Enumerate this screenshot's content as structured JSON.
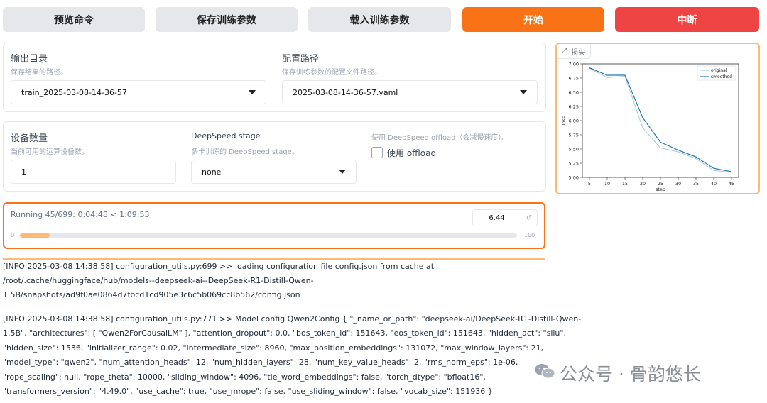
{
  "buttons": {
    "preview": "预览命令",
    "save": "保存训练参数",
    "load": "载入训练参数",
    "start": "开始",
    "stop": "中断"
  },
  "output_dir": {
    "label": "输出目录",
    "info": "保存结果的路径。",
    "value": "train_2025-03-08-14-36-57"
  },
  "config_path": {
    "label": "配置路径",
    "info": "保存训练参数的配置文件路径。",
    "value": "2025-03-08-14-36-57.yaml"
  },
  "device_count": {
    "label": "设备数量",
    "info": "当前可用的运算设备数。",
    "value": "1"
  },
  "deepspeed": {
    "label": "DeepSpeed stage",
    "info": "多卡训练的 DeepSpeed stage。",
    "value": "none"
  },
  "offload": {
    "info": "使用 DeepSpeed offload（会减慢速度）。",
    "label": "使用 offload",
    "checked": false
  },
  "progress": {
    "status": "Running 45/699: 0:04:48 < 1:09:53",
    "value": "6.44",
    "min": "0",
    "max": "100",
    "fraction": 0.06
  },
  "loss_chart": {
    "tab_label": "损失"
  },
  "chart_data": {
    "type": "line",
    "x": [
      5,
      10,
      15,
      20,
      25,
      30,
      35,
      40,
      45
    ],
    "series": [
      {
        "name": "original",
        "values": [
          6.92,
          6.76,
          6.78,
          5.87,
          5.52,
          5.45,
          5.33,
          5.12,
          5.09
        ]
      },
      {
        "name": "smoothed",
        "values": [
          6.93,
          6.8,
          6.8,
          6.05,
          5.62,
          5.48,
          5.36,
          5.16,
          5.1
        ]
      }
    ],
    "xlabel": "step",
    "ylabel": "loss",
    "ylim": [
      5.0,
      7.0
    ],
    "yticks": [
      "7.00",
      "6.75",
      "6.50",
      "6.25",
      "6.00",
      "5.75",
      "5.50",
      "5.25",
      "5.00"
    ],
    "xticks": [
      "5",
      "10",
      "15",
      "20",
      "25",
      "30",
      "35",
      "40",
      "45"
    ],
    "legend": "top-right",
    "colors": {
      "original": "#a9c5d9",
      "smoothed": "#1f77b4"
    }
  },
  "log_lines": [
    "[INFO|2025-03-08 14:38:58] configuration_utils.py:699 >> loading configuration file config.json from cache at",
    "/root/.cache/huggingface/hub/models--deepseek-ai--DeepSeek-R1-Distill-Qwen-",
    "1.5B/snapshots/ad9f0ae0864d7fbcd1cd905e3c6c5b069cc8b562/config.json",
    "[INFO|2025-03-08 14:38:58] configuration_utils.py:771 >> Model config Qwen2Config { \"_name_or_path\": \"deepseek-ai/DeepSeek-R1-Distill-Qwen-",
    "1.5B\", \"architectures\": [ \"Qwen2ForCausalLM\" ], \"attention_dropout\": 0.0, \"bos_token_id\": 151643, \"eos_token_id\": 151643, \"hidden_act\": \"silu\",",
    "\"hidden_size\": 1536, \"initializer_range\": 0.02, \"intermediate_size\": 8960, \"max_position_embeddings\": 131072, \"max_window_layers\": 21,",
    "\"model_type\": \"qwen2\", \"num_attention_heads\": 12, \"num_hidden_layers\": 28, \"num_key_value_heads\": 2, \"rms_norm_eps\": 1e-06,",
    "\"rope_scaling\": null, \"rope_theta\": 10000, \"sliding_window\": 4096, \"tie_word_embeddings\": false, \"torch_dtype\": \"bfloat16\",",
    "\"transformers_version\": \"4.49.0\", \"use_cache\": true, \"use_mrope\": false, \"use_sliding_window\": false, \"vocab_size\": 151936 }"
  ],
  "watermark": "公众号 · 骨韵悠长"
}
